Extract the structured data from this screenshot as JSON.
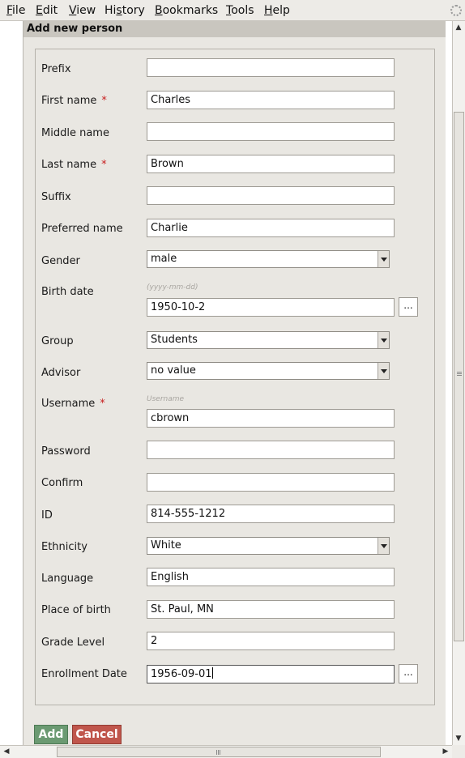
{
  "menubar": {
    "items": [
      {
        "accel": "F",
        "rest": "ile"
      },
      {
        "accel": "E",
        "rest": "dit"
      },
      {
        "accel": "V",
        "rest": "iew"
      },
      {
        "accel": "",
        "pre": "Hi",
        "accel2": "s",
        "rest": "tory"
      },
      {
        "accel": "B",
        "rest": "ookmarks"
      },
      {
        "accel": "T",
        "rest": "ools"
      },
      {
        "accel": "H",
        "rest": "elp"
      }
    ]
  },
  "panel": {
    "title": "Add new person"
  },
  "form": {
    "prefix": {
      "label": "Prefix",
      "value": ""
    },
    "first_name": {
      "label": "First name",
      "value": "Charles",
      "required": "*"
    },
    "middle_name": {
      "label": "Middle name",
      "value": ""
    },
    "last_name": {
      "label": "Last name",
      "value": "Brown",
      "required": "*"
    },
    "suffix": {
      "label": "Suffix",
      "value": ""
    },
    "preferred_name": {
      "label": "Preferred name",
      "value": "Charlie"
    },
    "gender": {
      "label": "Gender",
      "value": "male"
    },
    "birth_date": {
      "label": "Birth date",
      "hint": "(yyyy-mm-dd)",
      "value": "1950-10-2",
      "picker": "..."
    },
    "group": {
      "label": "Group",
      "value": "Students"
    },
    "advisor": {
      "label": "Advisor",
      "value": "no value"
    },
    "username": {
      "label": "Username",
      "hint": "Username",
      "value": "cbrown",
      "required": "*"
    },
    "password": {
      "label": "Password",
      "value": ""
    },
    "confirm": {
      "label": "Confirm",
      "value": ""
    },
    "id": {
      "label": "ID",
      "value": "814-555-1212"
    },
    "ethnicity": {
      "label": "Ethnicity",
      "value": "White"
    },
    "language": {
      "label": "Language",
      "value": "English"
    },
    "place_of_birth": {
      "label": "Place of birth",
      "value": "St. Paul, MN"
    },
    "grade_level": {
      "label": "Grade Level",
      "value": "2"
    },
    "enrollment_date": {
      "label": "Enrollment Date",
      "value": "1956-09-01",
      "picker": "..."
    }
  },
  "buttons": {
    "add": "Add",
    "cancel": "Cancel"
  },
  "colors": {
    "panel_bg": "#e9e7e2",
    "add_button": "#6b9a72",
    "cancel_button": "#c0564c",
    "required": "#c81e1e"
  }
}
